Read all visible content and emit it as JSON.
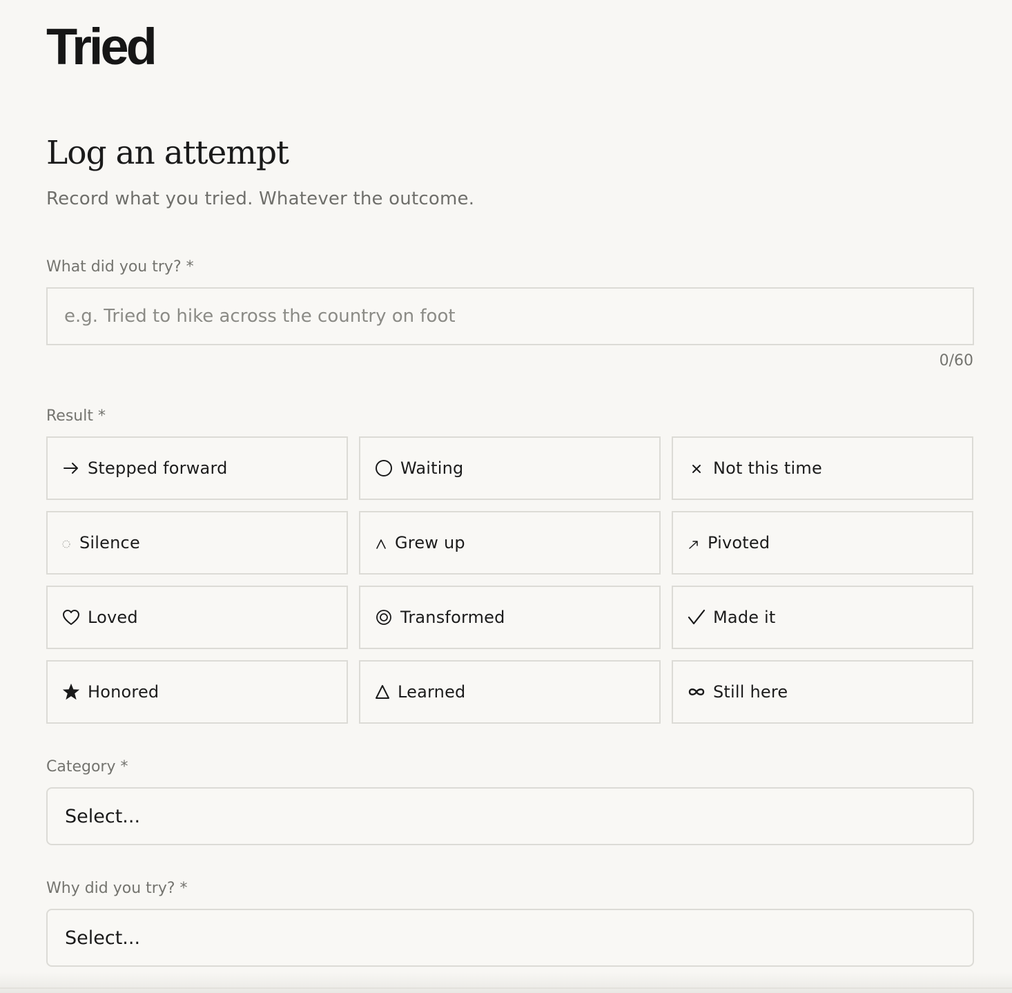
{
  "header": {
    "logo_text": "Tried"
  },
  "page": {
    "title": "Log an attempt",
    "subtitle": "Record what you tried. Whatever the outcome."
  },
  "attempt_field": {
    "label": "What did you try? *",
    "value": "",
    "placeholder": "e.g. Tried to hike across the country on foot",
    "counter": "0/60"
  },
  "result_field": {
    "label": "Result *",
    "options": [
      {
        "label": "Stepped forward",
        "icon": "arrow-right-icon"
      },
      {
        "label": "Waiting",
        "icon": "circle-icon"
      },
      {
        "label": "Not this time",
        "icon": "x-icon"
      },
      {
        "label": "Silence",
        "icon": "dotted-circle-icon"
      },
      {
        "label": "Grew up",
        "icon": "caret-up-icon"
      },
      {
        "label": "Pivoted",
        "icon": "arrow-up-right-icon"
      },
      {
        "label": "Loved",
        "icon": "heart-icon"
      },
      {
        "label": "Transformed",
        "icon": "target-icon"
      },
      {
        "label": "Made it",
        "icon": "checkmark-icon"
      },
      {
        "label": "Honored",
        "icon": "star-icon"
      },
      {
        "label": "Learned",
        "icon": "triangle-icon"
      },
      {
        "label": "Still here",
        "icon": "infinity-icon"
      }
    ]
  },
  "category_field": {
    "label": "Category *",
    "selected": "Select..."
  },
  "why_field": {
    "label": "Why did you try? *",
    "selected": "Select..."
  }
}
